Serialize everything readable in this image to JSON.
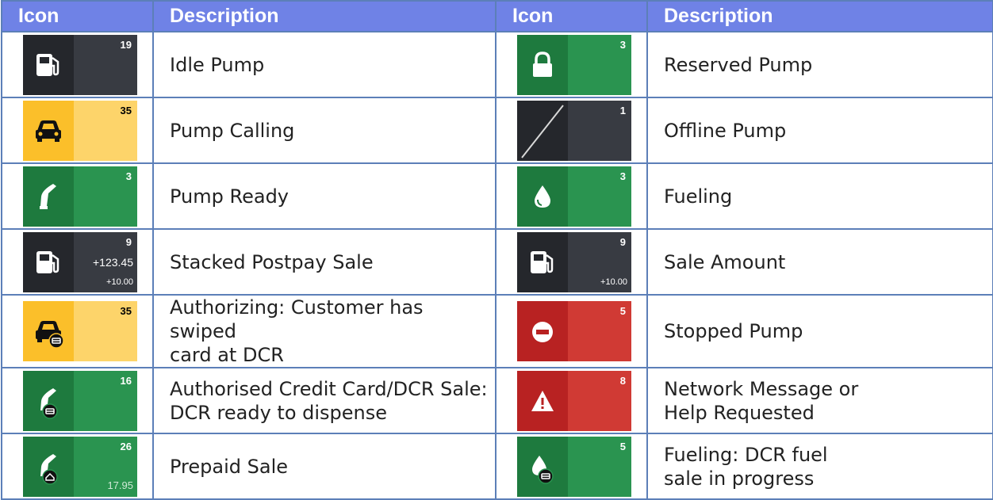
{
  "header": {
    "col_icon": "Icon",
    "col_description": "Description"
  },
  "colors": {
    "header_bg": "#6f82e6",
    "grid": "#5c7fb8",
    "dark": "#25272c",
    "green": "#2a9450",
    "yellow": "#fdd46a",
    "red": "#d03a34"
  },
  "rows": [
    {
      "left": {
        "icon": "pump-icon",
        "number": "19",
        "description": "Idle Pump"
      },
      "right": {
        "icon": "lock-icon",
        "number": "3",
        "description": "Reserved Pump"
      }
    },
    {
      "left": {
        "icon": "car-icon",
        "number": "35",
        "description": "Pump Calling"
      },
      "right": {
        "icon": "offline-slash-icon",
        "number": "1",
        "description": "Offline Pump"
      }
    },
    {
      "left": {
        "icon": "nozzle-icon",
        "number": "3",
        "description": "Pump Ready"
      },
      "right": {
        "icon": "drop-icon",
        "number": "3",
        "description": "Fueling"
      }
    },
    {
      "left": {
        "icon": "pump-icon",
        "number": "9",
        "amount": "+123.45",
        "sub_amount": "+10.00",
        "description": "Stacked Postpay Sale"
      },
      "right": {
        "icon": "pump-icon",
        "number": "9",
        "sub_amount": "+10.00",
        "description": "Sale Amount"
      }
    },
    {
      "left": {
        "icon": "car-card-icon",
        "number": "35",
        "description": "Authorizing: Customer has swiped\ncard at DCR"
      },
      "right": {
        "icon": "stop-icon",
        "number": "5",
        "description": "Stopped Pump"
      }
    },
    {
      "left": {
        "icon": "nozzle-card-icon",
        "number": "16",
        "description": "Authorised Credit Card/DCR Sale:\nDCR ready to dispense"
      },
      "right": {
        "icon": "warning-icon",
        "number": "8",
        "description": "Network Message or\nHelp Requested"
      }
    },
    {
      "left": {
        "icon": "nozzle-prepaid-icon",
        "number": "26",
        "sub_amount": "17.95",
        "description": "Prepaid Sale"
      },
      "right": {
        "icon": "drop-card-icon",
        "number": "5",
        "description": "Fueling: DCR fuel\nsale in progress"
      }
    }
  ]
}
